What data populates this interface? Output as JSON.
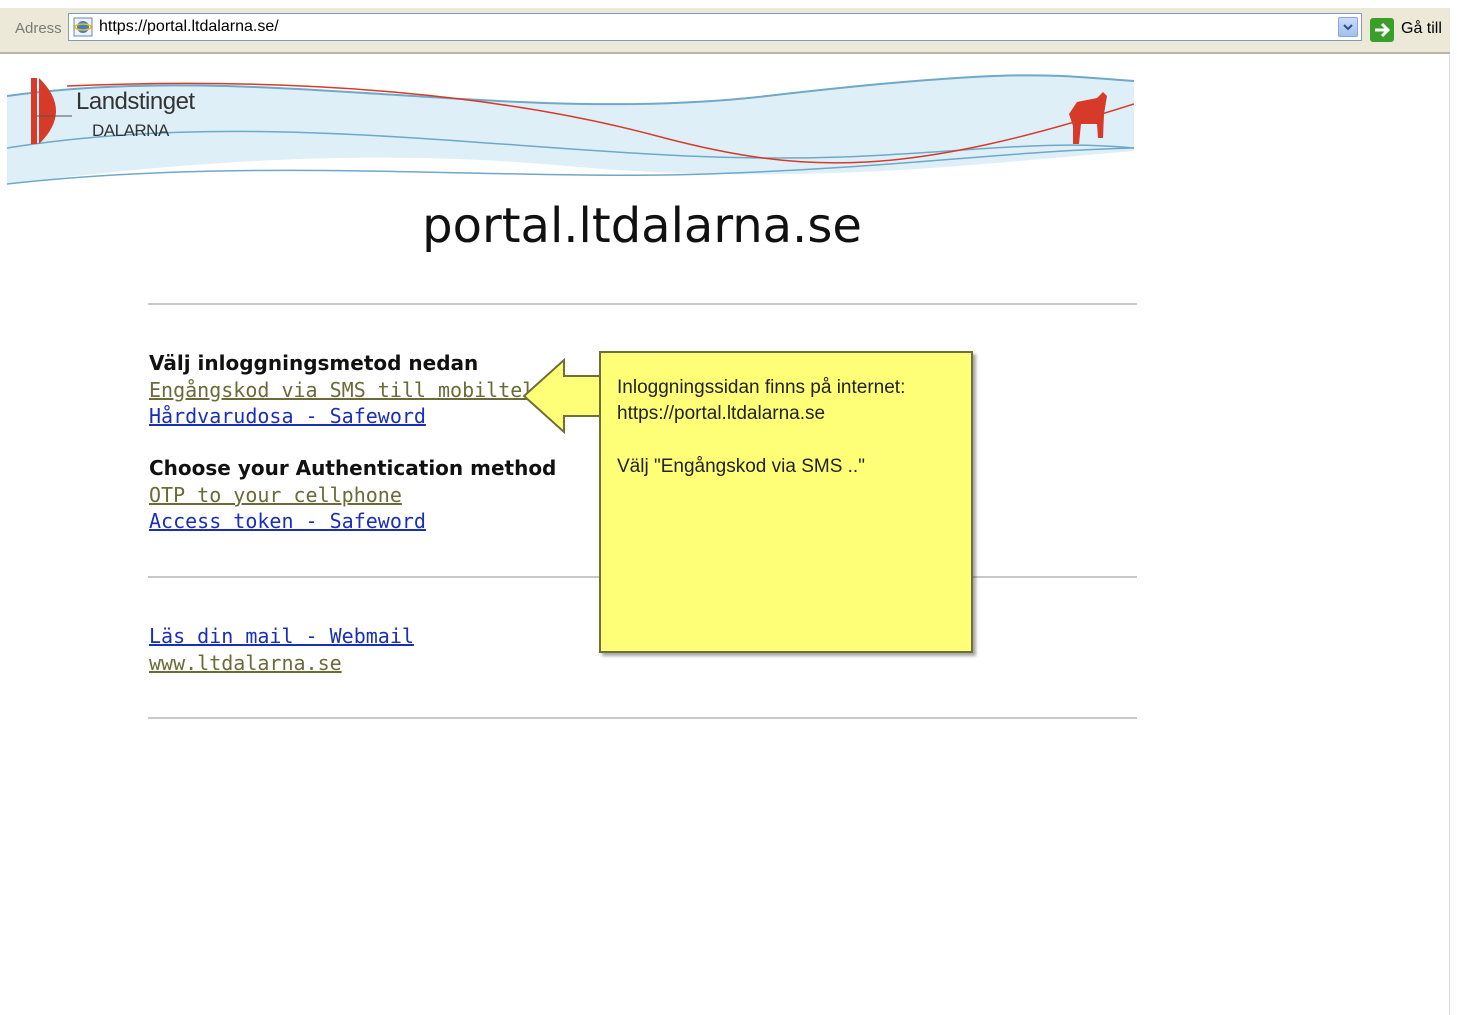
{
  "browser": {
    "address_label": "Adress",
    "url": "https://portal.ltdalarna.se/",
    "go_label": "Gå till"
  },
  "banner": {
    "logo_name": "Landstinget",
    "logo_sub": "DALARNA",
    "icons": [
      "landstinget-logo-icon",
      "dala-horse-icon"
    ]
  },
  "page": {
    "title": "portal.ltdalarna.se",
    "swedish": {
      "heading": "Välj inloggningsmetod nedan",
      "links": [
        "Engångskod via SMS till mobiltelefon",
        "Hårdvarudosa - Safeword"
      ]
    },
    "english": {
      "heading": "Choose your Authentication method",
      "links": [
        "OTP to your cellphone",
        "Access token - Safeword"
      ]
    },
    "other_links": [
      "Läs din mail - Webmail",
      "www.ltdalarna.se"
    ]
  },
  "callout": {
    "line1": "Inloggningssidan finns på internet:",
    "line2": "https://portal.ltdalarna.se",
    "line3": "Välj \"Engångskod via SMS ..\""
  },
  "colors": {
    "callout_bg": "#ffff77",
    "link_unvisited": "#1a2fb8",
    "link_visited": "#6b6b3a",
    "accent_red": "#d83a2a",
    "wave_blue": "#6fa8c8"
  }
}
